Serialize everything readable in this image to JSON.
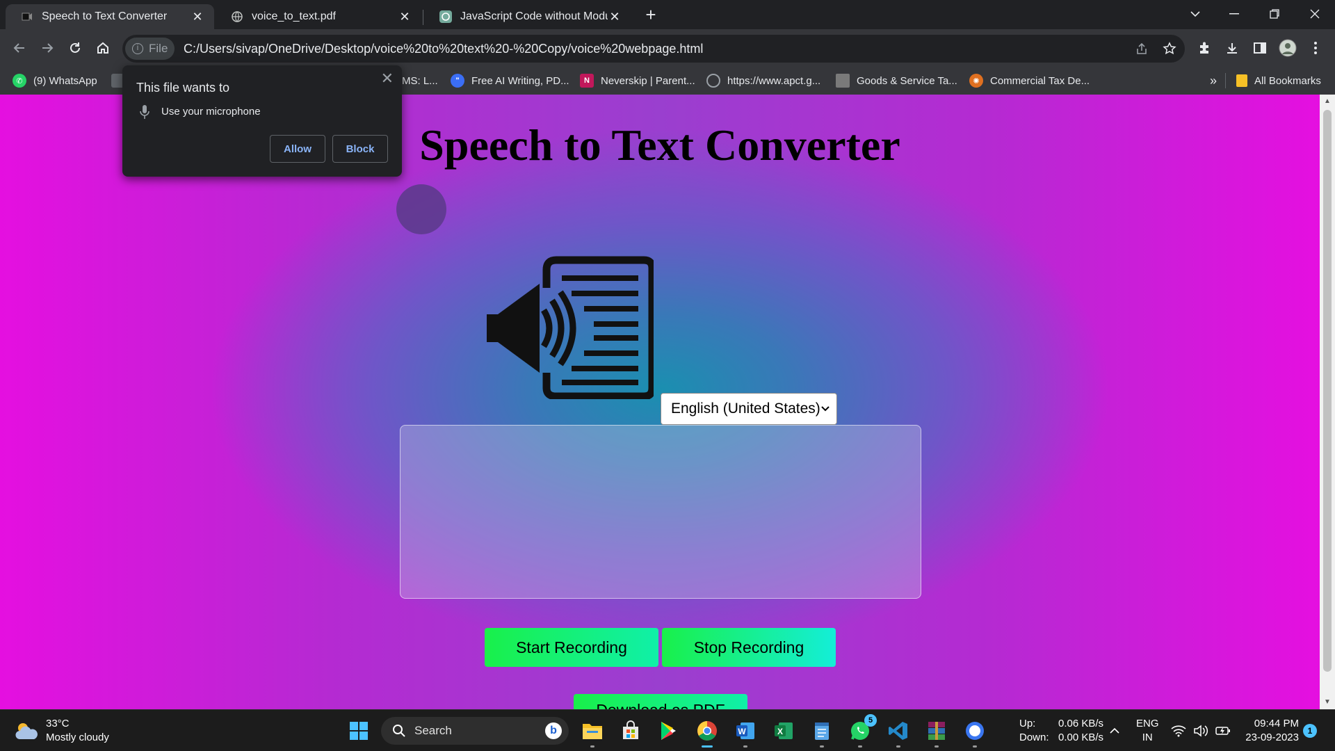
{
  "browser": {
    "tabs": [
      {
        "title": "Speech to Text Converter",
        "active": true
      },
      {
        "title": "voice_to_text.pdf",
        "active": false
      },
      {
        "title": "JavaScript Code without Module",
        "active": false
      }
    ],
    "new_tab": "+",
    "address": {
      "chip": "File",
      "url": "C:/Users/sivap/OneDrive/Desktop/voice%20to%20text%20-%20Copy/voice%20webpage.html"
    },
    "bookmarks": [
      {
        "label": "(9) WhatsApp",
        "icon": "whatsapp-icon",
        "color": "#25d366"
      },
      {
        "label": "MS: L...",
        "icon": "generic-icon",
        "color": "#5f6368"
      },
      {
        "label": "Free AI Writing, PD...",
        "icon": "ai-writing-icon",
        "color": "#3b6ef5"
      },
      {
        "label": "Neverskip | Parent...",
        "icon": "neverskip-icon",
        "color": "#c2185b"
      },
      {
        "label": "https://www.apct.g...",
        "icon": "globe-icon",
        "color": "#9aa0a6"
      },
      {
        "label": "Goods & Service Ta...",
        "icon": "gst-icon",
        "color": "#7a7a7a"
      },
      {
        "label": "Commercial Tax De...",
        "icon": "tax-icon",
        "color": "#e07020"
      }
    ],
    "more_bookmarks": "»",
    "all_bookmarks": "All Bookmarks"
  },
  "permission_popup": {
    "title": "This file wants to",
    "description": "Use your microphone",
    "allow_label": "Allow",
    "block_label": "Block"
  },
  "page": {
    "title": "Speech to Text Converter",
    "language_selected": "English (United States)",
    "transcript_text": "",
    "start_button": "Start Recording",
    "stop_button": "Stop Recording",
    "download_button": "Download as PDF"
  },
  "taskbar": {
    "weather": {
      "temp": "33°C",
      "condition": "Mostly cloudy"
    },
    "search_placeholder": "Search",
    "apps": [
      "file-explorer-icon",
      "microsoft-store-icon",
      "google-play-icon",
      "chrome-icon",
      "word-icon",
      "excel-icon",
      "notepad-icon",
      "whatsapp-icon",
      "vscode-icon",
      "winrar-icon",
      "signal-icon"
    ],
    "whatsapp_badge": "5",
    "network": {
      "up_label": "Up:",
      "up_value": "0.06 KB/s",
      "down_label": "Down:",
      "down_value": "0.00 KB/s"
    },
    "language": {
      "line1": "ENG",
      "line2": "IN"
    },
    "clock": {
      "time": "09:44 PM",
      "date": "23-09-2023"
    },
    "notification_count": "1"
  }
}
